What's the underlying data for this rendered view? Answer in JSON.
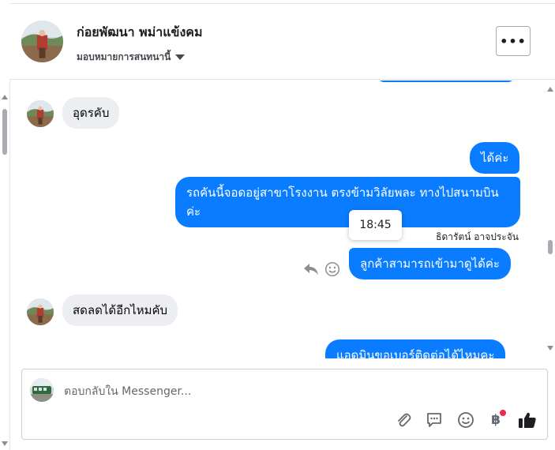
{
  "header": {
    "contact_name": "ก่อยพัฒนา พม่าแข้งคม",
    "assign_label": "มอบหมายการสนทนานี้",
    "more_label": "•••"
  },
  "messages": [
    {
      "direction": "incoming",
      "text": "อุดรคับ"
    },
    {
      "direction": "outgoing",
      "text": "ได้ค่ะ"
    },
    {
      "direction": "outgoing",
      "text": "รถคันนี้จอดอยู่สาขาโรงงาน ตรงข้ามวิลัยพละ ทางไปสนามบินค่ะ"
    },
    {
      "direction": "outgoing",
      "text": "ลูกค้าสามารถเข้ามาดูได้ค่ะ"
    },
    {
      "direction": "incoming",
      "text": "สดลดได้อีกไหมคับ"
    },
    {
      "direction": "outgoing",
      "text": "แอดมินขอเบอร์ติดต่อได้ไหมคะ"
    }
  ],
  "tooltip_time": "18:45",
  "sender_name": "ธิดารัตน์ อาจประจัน",
  "composer": {
    "placeholder": "ตอบกลับใน Messenger...",
    "value": ""
  },
  "icons": [
    "attachment-icon",
    "saved-reply-icon",
    "emoji-icon",
    "baht-payment-icon",
    "like-icon",
    "reply-icon",
    "react-icon",
    "more-icon"
  ],
  "baht_symbol": "฿",
  "colors": {
    "outgoing_bubble": "#0a7cff",
    "incoming_bubble": "#eceef1",
    "notification_dot": "#f02849"
  }
}
